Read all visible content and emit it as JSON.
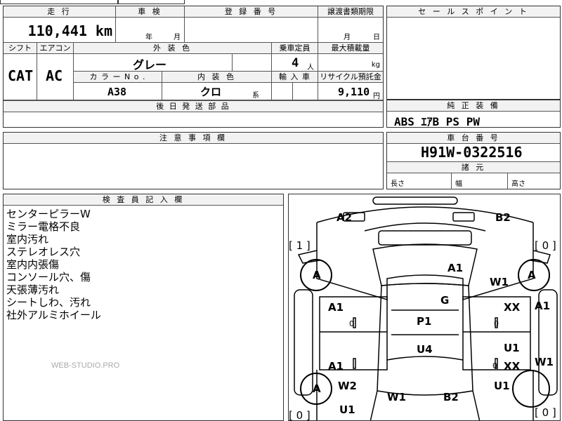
{
  "top_partial": {
    "left": "車",
    "mid": "日付 月 日"
  },
  "sheet": {
    "mileage_header": "走 行",
    "mileage_value": "110,441 km",
    "inspection_header": "車 検",
    "inspection_year": "年",
    "inspection_month": "月",
    "registration_header": "登 録 番 号",
    "transfer_header": "譲渡書類期限",
    "transfer_month": "月",
    "transfer_day": "日",
    "shift_header": "シフト",
    "shift_value": "CAT",
    "ac_header": "エアコン",
    "ac_value": "AC",
    "exterior_color_header": "外 装 色",
    "exterior_color_value": "グレー",
    "seating_header": "乗車定員",
    "seating_value": "4",
    "seating_unit": "人",
    "max_load_header": "最大積載量",
    "max_load_unit": "kg",
    "color_no_header": "カ ラ ー N o .",
    "color_no_value": "A38",
    "interior_color_header": "内 装 色",
    "interior_color_value": "クロ",
    "interior_color_suffix": "系",
    "import_header": "輸 入 車",
    "recycle_header": "リサイクル預託金",
    "recycle_value": "9,110",
    "recycle_unit": "円",
    "later_parts_header": "後 日 発 送 部 品"
  },
  "sales_point": {
    "header": "セ ー ル ス ポ イ ン ト"
  },
  "standard_equipment": {
    "header": "純 正 装 備",
    "value": "ABS ｴｱB PS PW"
  },
  "caution": {
    "header": "注 意 事 項 欄"
  },
  "chassis": {
    "header": "車 台 番 号",
    "value": "H91W-0322516",
    "dims_header": "諸 元",
    "length_label": "長さ",
    "width_label": "幅",
    "height_label": "高さ"
  },
  "inspector": {
    "header": "検 査 員 記 入 欄",
    "notes": [
      "センターピラーW",
      "ミラー電格不良",
      "室内汚れ",
      "ステレオレス穴",
      "室内内張傷",
      "コンソール穴、傷",
      "天張薄汚れ",
      "シートしわ、汚れ",
      "社外アルミホイール"
    ],
    "watermark": "WEB-STUDIO.PRO"
  },
  "diagram": {
    "a2": "A2",
    "b2_top": "B2",
    "left_count_top": "[ 1 ]",
    "right_count_top": "[ 0 ]",
    "wheel_fl": "A",
    "wheel_fr": "A",
    "wheel_rl": "A",
    "hood": "A1",
    "w1_right_front": "W1",
    "g": "G",
    "door_left_front": "A1",
    "door_right_front": "XX",
    "right_fender": "A1",
    "p1": "P1",
    "u4": "U4",
    "right_rear_u1": "U1",
    "right_rear_xx": "XX",
    "right_rear_w1": "W1",
    "left_rear_a1": "A1",
    "w2": "W2",
    "u1_right_lower": "U1",
    "w1_bottom": "W1",
    "b2_bottom": "B2",
    "u1_left_bottom": "U1",
    "left_count_bottom": "[ 0 ]",
    "right_count_bottom": "[ 0 ]",
    "small_0_right_front": "0",
    "small_0_left_front": "0",
    "small_0_right_rear": "0"
  }
}
